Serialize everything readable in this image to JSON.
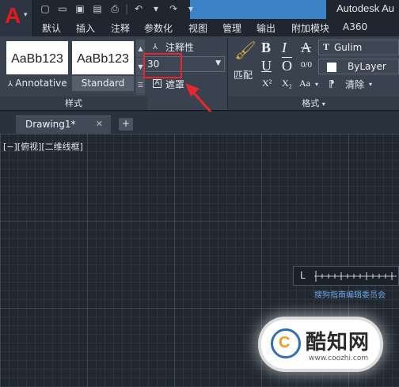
{
  "window": {
    "title": "Autodesk Au",
    "app_button_icon": "autocad-logo-icon",
    "accent": "#e01b1b"
  },
  "quick_access": [
    "new-file-icon",
    "open-icon",
    "save-icon",
    "save-as-icon",
    "print-icon",
    "undo-icon",
    "redo-icon"
  ],
  "menu_tabs": [
    "默认",
    "插入",
    "注释",
    "参数化",
    "视图",
    "管理",
    "输出",
    "附加模块",
    "A360"
  ],
  "ribbon": {
    "styles_panel": {
      "title": "样式",
      "text_styles": [
        {
          "sample": "AaBb123",
          "label": "Annotative"
        },
        {
          "sample": "AaBb123",
          "label": "Standard"
        }
      ]
    },
    "annotative_label": "注释性",
    "text_height": {
      "value": "30"
    },
    "mask_label": "遮罩",
    "match_label": "匹配",
    "format_panel": {
      "title": "格式",
      "bold": "B",
      "italic": "I",
      "strikethrough": "A",
      "underline": "U",
      "overline": "O",
      "oblique": "0/0",
      "superscript": "X²",
      "subscript": "X₂",
      "case": "Aa",
      "clear_label": "清除",
      "font": {
        "glyph": "T",
        "name": "Gulim"
      },
      "color": {
        "name": "ByLayer",
        "swatch": "#ffffff"
      }
    },
    "highlight_color": "#e8272c"
  },
  "document": {
    "tab_name": "Drawing1*",
    "close": "✕",
    "add": "+"
  },
  "viewport": {
    "label": "[−][俯视][二维线框]"
  },
  "scale_caption": "搜狗指南编辑委员会",
  "watermark": {
    "title": "酷知网",
    "url": "www.coozhi.com",
    "mark": "C"
  }
}
